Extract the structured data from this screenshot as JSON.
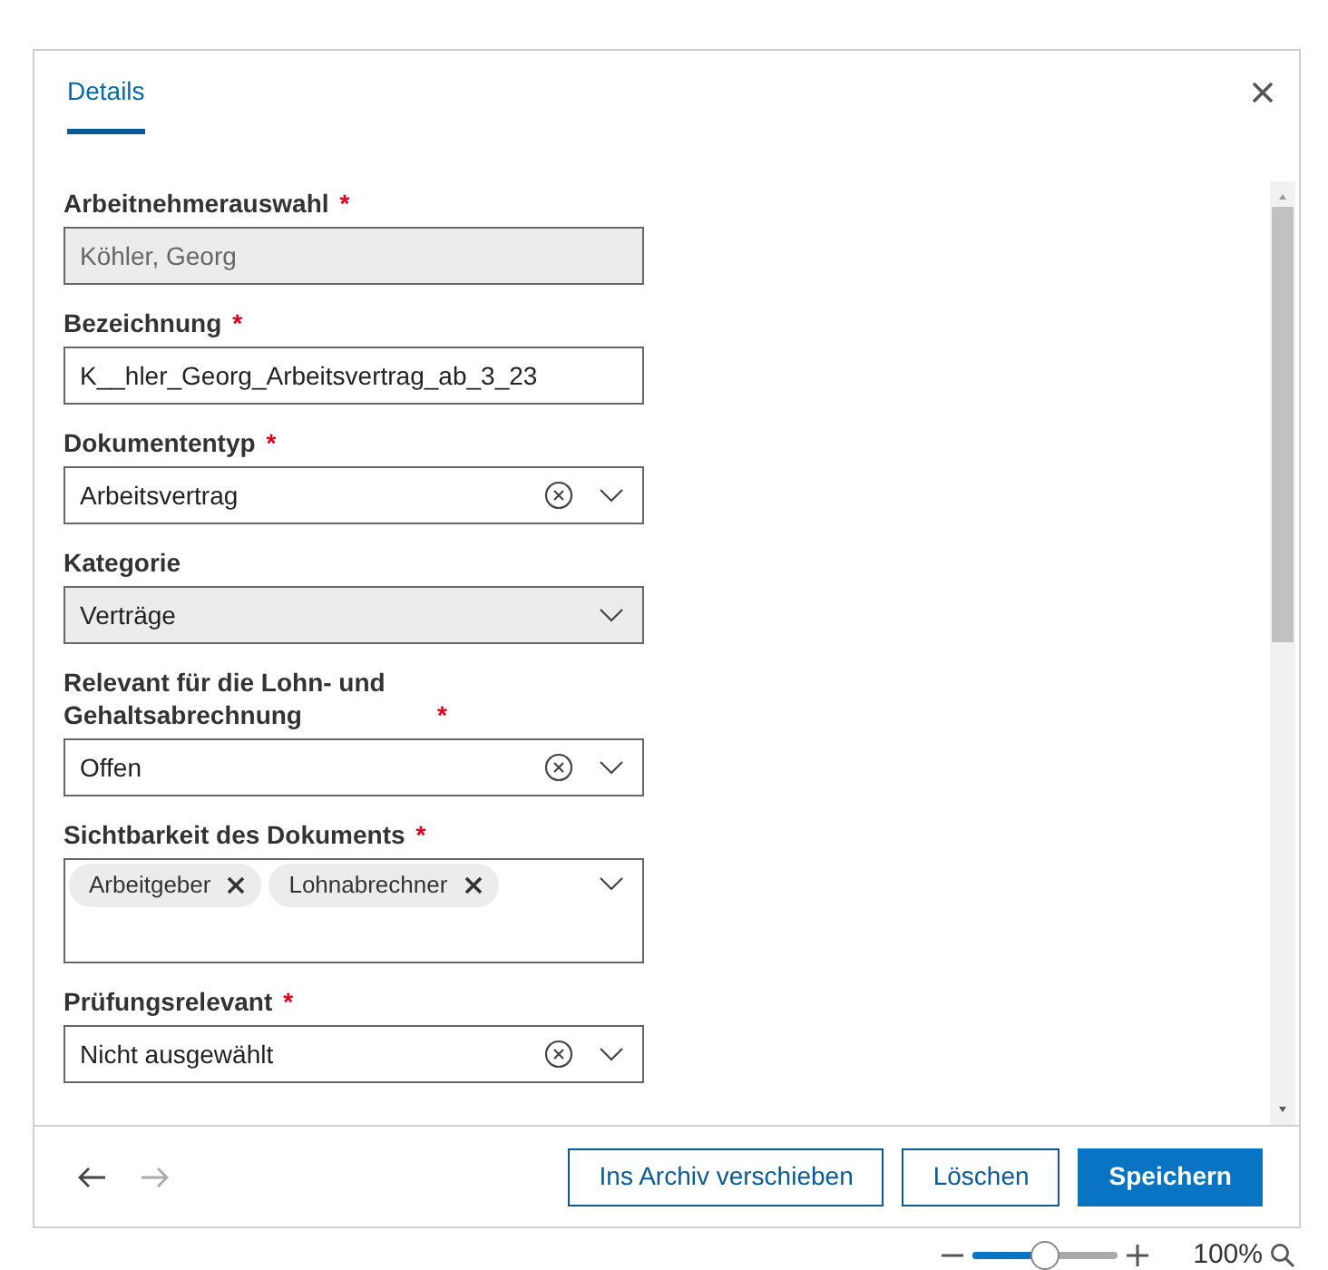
{
  "tabs": [
    {
      "label": "Details",
      "selected": true
    }
  ],
  "fields": [
    {
      "kind": "text",
      "label": "Arbeitnehmerauswahl",
      "required_mark": "*",
      "disabled": true,
      "value": "Köhler, Georg"
    },
    {
      "kind": "text",
      "label": "Bezeichnung",
      "required_mark": "*",
      "disabled": false,
      "value": "K__hler_Georg_Arbeitsvertrag_ab_3_23"
    },
    {
      "kind": "select",
      "label": "Dokumententyp",
      "required_mark": "*",
      "disabled": false,
      "clearable": true,
      "value": "Arbeitsvertrag"
    },
    {
      "kind": "select",
      "label": "Kategorie",
      "disabled": true,
      "clearable": false,
      "value": "Verträge"
    },
    {
      "kind": "select",
      "label": "Relevant für die Lohn- und Gehaltsabrechnung",
      "required_mark": "*",
      "disabled": false,
      "clearable": true,
      "value": "Offen"
    },
    {
      "kind": "tags",
      "label": "Sichtbarkeit des Dokuments",
      "required_mark": "*",
      "tags": [
        "Arbeitgeber",
        "Lohnabrechner"
      ]
    },
    {
      "kind": "select",
      "label": "Prüfungsrelevant",
      "required_mark": "*",
      "disabled": false,
      "clearable": true,
      "value": "Nicht ausgewählt"
    }
  ],
  "footer": {
    "buttons": [
      {
        "label": "Ins Archiv verschieben",
        "kind": "outline"
      },
      {
        "label": "Löschen",
        "kind": "outline"
      },
      {
        "label": "Speichern",
        "kind": "primary"
      }
    ],
    "back_disabled": false,
    "forward_disabled": true
  },
  "zoom": {
    "level": 0.5,
    "reading": "100%"
  }
}
